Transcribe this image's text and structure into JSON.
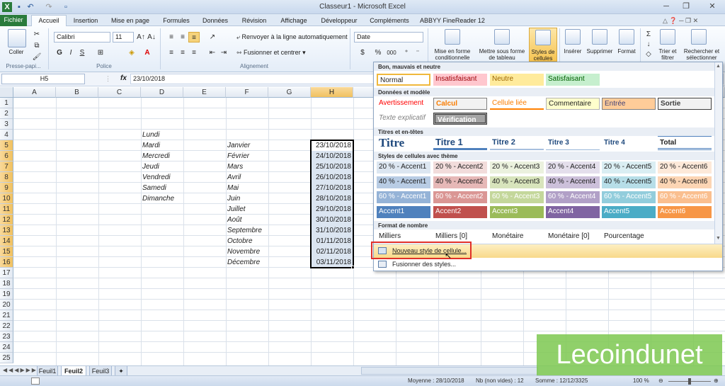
{
  "window": {
    "title": "Classeur1 - Microsoft Excel"
  },
  "tabs": [
    "Fichier",
    "Accueil",
    "Insertion",
    "Mise en page",
    "Formules",
    "Données",
    "Révision",
    "Affichage",
    "Développeur",
    "Compléments",
    "ABBYY FineReader 12"
  ],
  "ribbon": {
    "clipboard": {
      "paste": "Coller",
      "group": "Presse-papi..."
    },
    "font": {
      "name": "Calibri",
      "size": "11",
      "bold": "G",
      "italic": "I",
      "underline": "S",
      "group": "Police"
    },
    "alignment": {
      "wrap": "Renvoyer à la ligne automatiquement",
      "merge": "Fusionner et centrer",
      "group": "Alignement"
    },
    "number": {
      "format": "Date",
      "percent": "%",
      "thousands": "000"
    },
    "styles": {
      "conditional": "Mise en forme conditionnelle",
      "table": "Mettre sous forme de tableau",
      "cellstyles": "Styles de cellules"
    },
    "cells": {
      "insert": "Insérer",
      "delete": "Supprimer",
      "format": "Format"
    },
    "editing": {
      "sort": "Trier et filtrer",
      "find": "Rechercher et sélectionner"
    }
  },
  "formula": {
    "namebox": "H5",
    "fx": "fx",
    "value": "23/10/2018"
  },
  "columns": [
    "A",
    "B",
    "C",
    "D",
    "E",
    "F",
    "G",
    "H"
  ],
  "rows": [
    "1",
    "2",
    "3",
    "4",
    "5",
    "6",
    "7",
    "8",
    "9",
    "10",
    "11",
    "12",
    "13",
    "14",
    "15",
    "16",
    "17",
    "18",
    "19",
    "20",
    "21",
    "22",
    "23",
    "24",
    "25"
  ],
  "col_d": [
    "Lundi",
    "Mardi",
    "Mercredi",
    "Jeudi",
    "Vendredi",
    "Samedi",
    "Dimanche"
  ],
  "col_f": [
    "Janvier",
    "Février",
    "Mars",
    "Avril",
    "Mai",
    "Juin",
    "Juillet",
    "Août",
    "Septembre",
    "Octobre",
    "Novembre",
    "Décembre"
  ],
  "col_h": [
    "23/10/2018",
    "24/10/2018",
    "25/10/2018",
    "26/10/2018",
    "27/10/2018",
    "28/10/2018",
    "29/10/2018",
    "30/10/2018",
    "31/10/2018",
    "01/11/2018",
    "02/11/2018",
    "03/11/2018"
  ],
  "gallery": {
    "good_bad": {
      "header": "Bon, mauvais et neutre",
      "items": [
        "Normal",
        "Insatisfaisant",
        "Neutre",
        "Satisfaisant"
      ]
    },
    "data_model": {
      "header": "Données et modèle",
      "items": [
        "Avertissement",
        "Calcul",
        "Cellule liée",
        "Commentaire",
        "Entrée",
        "Sortie",
        "Texte explicatif",
        "Vérification"
      ]
    },
    "titles": {
      "header": "Titres et en-têtes",
      "items": [
        "Titre",
        "Titre 1",
        "Titre 2",
        "Titre 3",
        "Titre 4",
        "Total"
      ]
    },
    "themed": {
      "header": "Styles de cellules avec thème",
      "row20": [
        "20 % - Accent1",
        "20 % - Accent2",
        "20 % - Accent3",
        "20 % - Accent4",
        "20 % - Accent5",
        "20 % - Accent6"
      ],
      "row40": [
        "40 % - Accent1",
        "40 % - Accent2",
        "40 % - Accent3",
        "40 % - Accent4",
        "40 % - Accent5",
        "40 % - Accent6"
      ],
      "row60": [
        "60 % - Accent1",
        "60 % - Accent2",
        "60 % - Accent3",
        "60 % - Accent4",
        "60 % - Accent5",
        "60 % - Accent6"
      ],
      "accent": [
        "Accent1",
        "Accent2",
        "Accent3",
        "Accent4",
        "Accent5",
        "Accent6"
      ]
    },
    "number_format": {
      "header": "Format de nombre",
      "items": [
        "Milliers",
        "Milliers [0]",
        "Monétaire",
        "Monétaire [0]",
        "Pourcentage"
      ]
    },
    "new_style": "Nouveau style de cellule...",
    "merge_styles": "Fusionner des styles..."
  },
  "sheets": [
    "Feuil1",
    "Feuil2",
    "Feuil3"
  ],
  "status": {
    "average": "Moyenne : 28/10/2018",
    "count": "Nb (non vides) : 12",
    "sum": "Somme : 12/12/3325",
    "zoom": "100 %"
  },
  "watermark": "Lecoindunet",
  "colors": {
    "accent1": "#4f81bd",
    "accent2": "#c0504d",
    "accent3": "#9bbb59",
    "accent4": "#8064a2",
    "accent5": "#4bacc6",
    "accent6": "#f79646",
    "excel_green": "#2a7b3c",
    "highlight": "#f6c452"
  }
}
